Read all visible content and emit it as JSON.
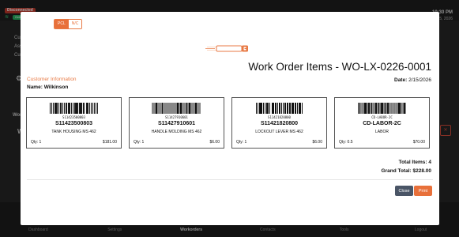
{
  "status_bar": {
    "disconnected_badge": "Disconnected",
    "online_badge": "Online",
    "clock": "10:30 PM",
    "date": "2/15, 2026"
  },
  "background": {
    "left_labels": [
      "Cust",
      "Ass",
      "Cust"
    ],
    "section_labels": [
      "Wor",
      "W"
    ]
  },
  "modal": {
    "toggle": {
      "pcl": "PCL",
      "zpl": "N/C"
    },
    "title": "Work Order Items - WO-LX-0226-0001",
    "date_label": "Date:",
    "date_value": "2/15/2026",
    "customer_heading": "Customer Information",
    "name_label": "Name:",
    "name_value": "Wilkinson",
    "items": [
      {
        "barcode_text": "S11423500803",
        "code": "S11423500803",
        "description": "TANK HOUSING MS 462",
        "qty_label": "Qty: 1",
        "price": "$181.00"
      },
      {
        "barcode_text": "S11427910601",
        "code": "S11427910601",
        "description": "HANDLE MOLDING MS 462",
        "qty_label": "Qty: 1",
        "price": "$6.00"
      },
      {
        "barcode_text": "S11421820800",
        "code": "S11421820800",
        "description": "LOCKOUT LEVER MS 462",
        "qty_label": "Qty: 1",
        "price": "$6.00"
      },
      {
        "barcode_text": "CD-LABOR-2C",
        "code": "CD-LABOR-2C",
        "description": "LABOR",
        "qty_label": "Qty: 0.5",
        "price": "$70.00"
      }
    ],
    "total_items": "Total Items: 4",
    "grand_total": "Grand Total: $228.00",
    "close_button": "Close",
    "print_button": "Print"
  },
  "bottom_nav": [
    {
      "label": "Dashboard"
    },
    {
      "label": "Settings"
    },
    {
      "label": "Workorders",
      "active": true
    },
    {
      "label": "Contacts"
    },
    {
      "label": "Tools"
    },
    {
      "label": "Logout"
    }
  ],
  "colors": {
    "accent": "#e8703a",
    "close_button": "#4a5566"
  }
}
